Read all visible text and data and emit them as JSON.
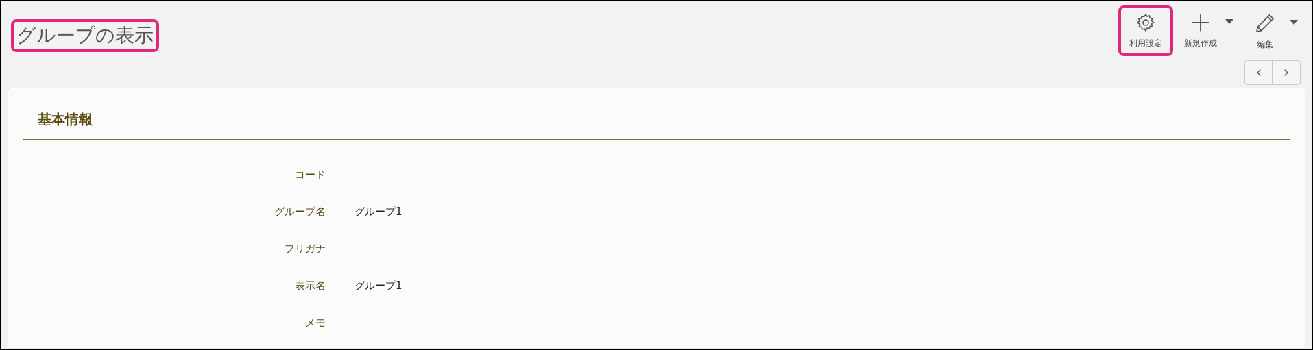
{
  "page_title": {
    "text": "グループの表示",
    "highlighted": true
  },
  "toolbar": [
    {
      "kind": "gear",
      "label": "利用設定",
      "dropdown": false,
      "highlighted": true
    },
    {
      "kind": "plus",
      "label": "新規作成",
      "dropdown": true,
      "highlighted": false
    },
    {
      "kind": "pencil",
      "label": "編集",
      "dropdown": true,
      "highlighted": false
    }
  ],
  "section": {
    "title": "基本情報",
    "fields": [
      {
        "label": "コード"
      },
      {
        "label": "グループ名",
        "value": "グループ1"
      },
      {
        "label": "フリガナ"
      },
      {
        "label": "表示名",
        "value": "グループ1"
      },
      {
        "label": "メモ"
      }
    ]
  }
}
